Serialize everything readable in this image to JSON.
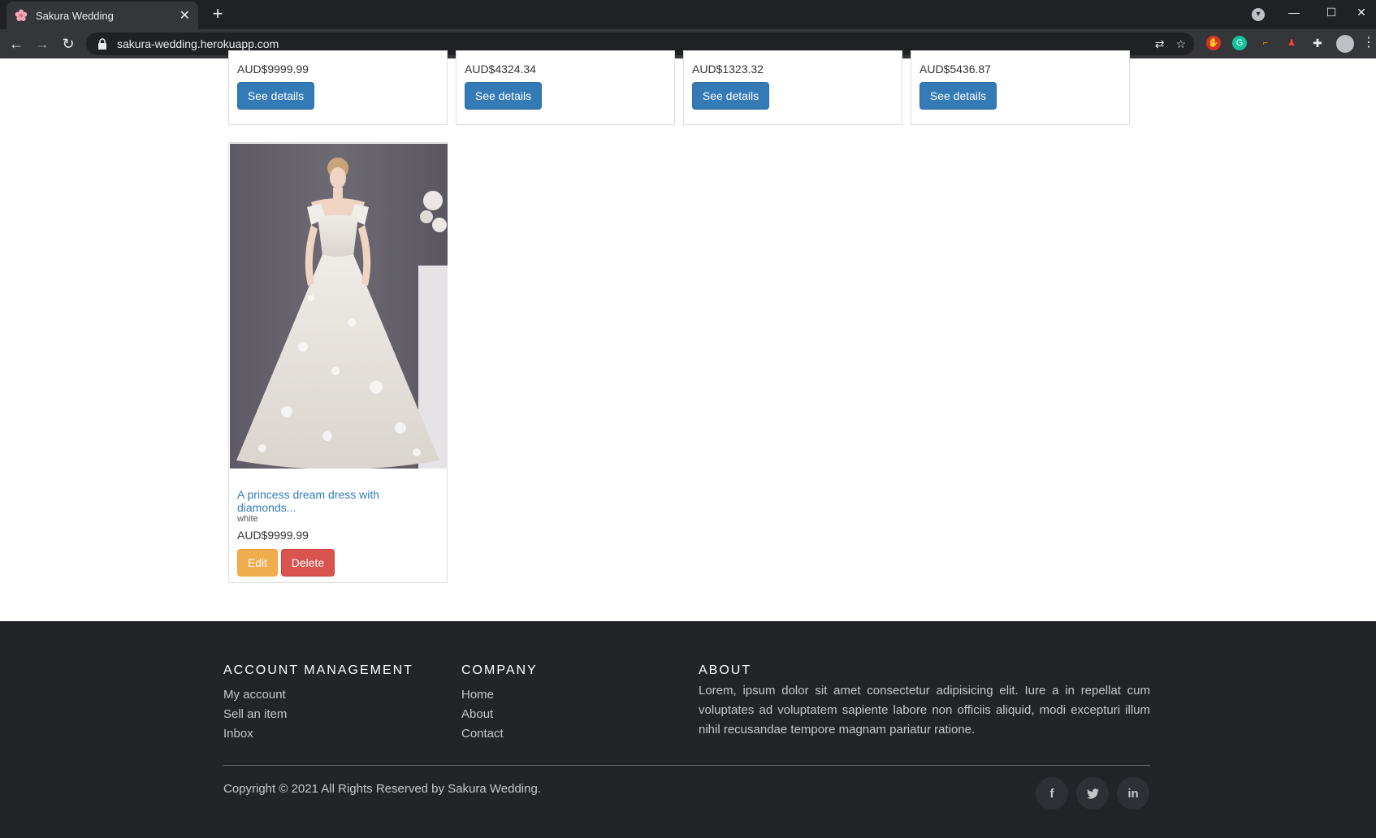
{
  "browser": {
    "tab_title": "Sakura Wedding",
    "tab_close": "✕",
    "new_tab": "+",
    "url": "sakura-wedding.herokuapp.com"
  },
  "products_top": [
    {
      "price": "AUD$9999.99",
      "button": "See details"
    },
    {
      "price": "AUD$4324.34",
      "button": "See details"
    },
    {
      "price": "AUD$1323.32",
      "button": "See details"
    },
    {
      "price": "AUD$5436.87",
      "button": "See details"
    }
  ],
  "product_featured": {
    "title": "A princess dream dress with diamonds...",
    "color": "white",
    "price": "AUD$9999.99",
    "edit_label": "Edit",
    "delete_label": "Delete"
  },
  "footer": {
    "account": {
      "heading": "ACCOUNT MANAGEMENT",
      "links": [
        "My account",
        "Sell an item",
        "Inbox"
      ]
    },
    "company": {
      "heading": "COMPANY",
      "links": [
        "Home",
        "About",
        "Contact"
      ]
    },
    "about": {
      "heading": "ABOUT",
      "text": "Lorem, ipsum dolor sit amet consectetur adipisicing elit. Iure a in repellat cum voluptates ad voluptatem sapiente labore non officiis aliquid, modi excepturi illum nihil recusandae tempore magnam pariatur ratione."
    },
    "copyright": "Copyright © 2021 All Rights Reserved by Sakura Wedding.",
    "social": {
      "facebook": "f",
      "twitter": "t",
      "linkedin": "in"
    }
  },
  "colors": {
    "primary": "#337ab7",
    "warning": "#f0ad4e",
    "danger": "#d9534f",
    "footer_bg": "#232428"
  }
}
